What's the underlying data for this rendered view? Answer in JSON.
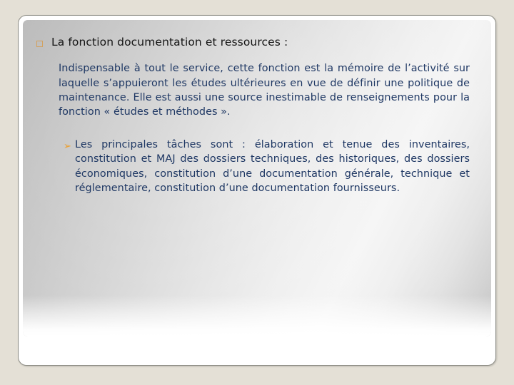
{
  "slide": {
    "heading": {
      "bullet_icon": "hollow-square-bullet",
      "bullet_color": "#d3a15e",
      "text": "La fonction documentation et ressources :",
      "color": "#141414"
    },
    "paragraph": {
      "text": "Indispensable à tout le service, cette fonction est la mémoire de l’activité sur laquelle s’appuieront les études ultérieures en vue de définir une politique de maintenance. Elle est aussi une source inestimable de renseignements pour la fonction « études et méthodes ».",
      "color": "#1f3864",
      "align": "justify"
    },
    "sub_item": {
      "bullet_icon": "arrow-head-bullet",
      "bullet_glyph": "➢",
      "bullet_color": "#e8a33d",
      "text": "Les principales tâches sont : élaboration et tenue des inventaires, constitution et MAJ des dossiers techniques, des historiques, des dossiers économiques, constitution d’une documentation générale, technique et réglementaire, constitution d’une documentation fournisseurs.",
      "color": "#1f3864",
      "align": "justify"
    },
    "theme": {
      "outer_background": "#e4e0d6",
      "frame_background": "#ffffff",
      "frame_border": "#8d8d85",
      "panel_gradient_light": "#f4f4f4",
      "panel_gradient_dark": "#b9b9b9"
    }
  }
}
